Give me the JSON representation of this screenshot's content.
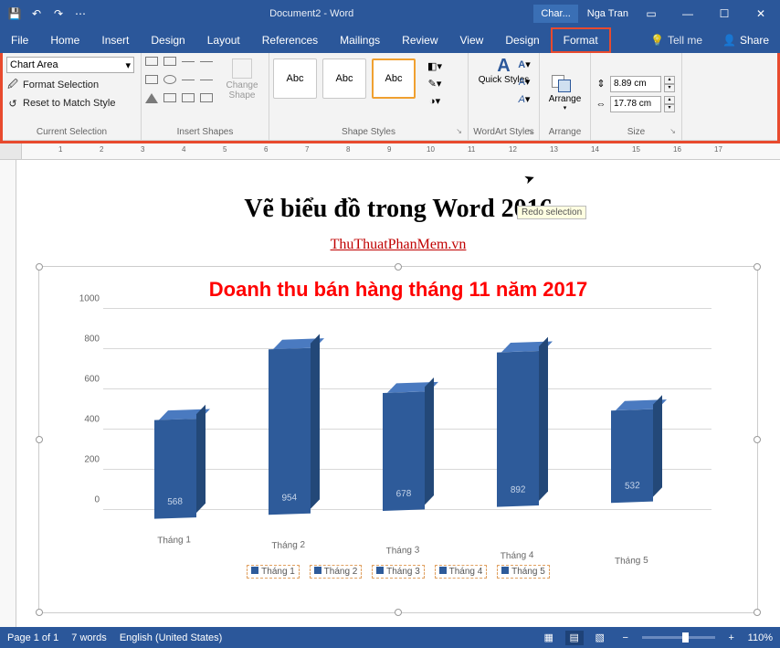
{
  "titlebar": {
    "doc_name": "Document2 - Word",
    "context_tab": "Char...",
    "user": "Nga Tran"
  },
  "menu": {
    "file": "File",
    "home": "Home",
    "insert": "Insert",
    "design": "Design",
    "layout": "Layout",
    "references": "References",
    "mailings": "Mailings",
    "review": "Review",
    "view": "View",
    "design2": "Design",
    "format": "Format",
    "tell_me": "Tell me",
    "share": "Share"
  },
  "ribbon": {
    "current_selection": {
      "dropdown_value": "Chart Area",
      "format_selection": "Format Selection",
      "reset_match": "Reset to Match Style",
      "group_label": "Current Selection"
    },
    "insert_shapes": {
      "change_shape": "Change Shape",
      "group_label": "Insert Shapes"
    },
    "shape_styles": {
      "abc": "Abc",
      "group_label": "Shape Styles"
    },
    "wordart": {
      "quick_styles": "Quick Styles",
      "group_label": "WordArt Styles"
    },
    "arrange": {
      "label": "Arrange",
      "group_label": "Arrange"
    },
    "size": {
      "height": "8.89 cm",
      "width": "17.78 cm",
      "group_label": "Size"
    }
  },
  "document": {
    "heading": "Vẽ biểu đồ trong Word 2016",
    "link": "ThuThuatPhanMem.vn",
    "tooltip_redo": "Redo selection"
  },
  "chart_data": {
    "type": "bar",
    "title": "Doanh thu bán hàng tháng 11 năm 2017",
    "categories": [
      "Tháng 1",
      "Tháng 2",
      "Tháng 3",
      "Tháng 4",
      "Tháng 5"
    ],
    "values": [
      568,
      954,
      678,
      892,
      532
    ],
    "ylabel": "",
    "xlabel": "",
    "ylim": [
      0,
      1000
    ],
    "yticks": [
      0,
      200,
      400,
      600,
      800,
      1000
    ],
    "legend": [
      "Tháng 1",
      "Tháng 2",
      "Tháng 3",
      "Tháng 4",
      "Tháng 5"
    ]
  },
  "statusbar": {
    "page": "Page 1 of 1",
    "words": "7 words",
    "lang": "English (United States)",
    "zoom": "110%"
  }
}
